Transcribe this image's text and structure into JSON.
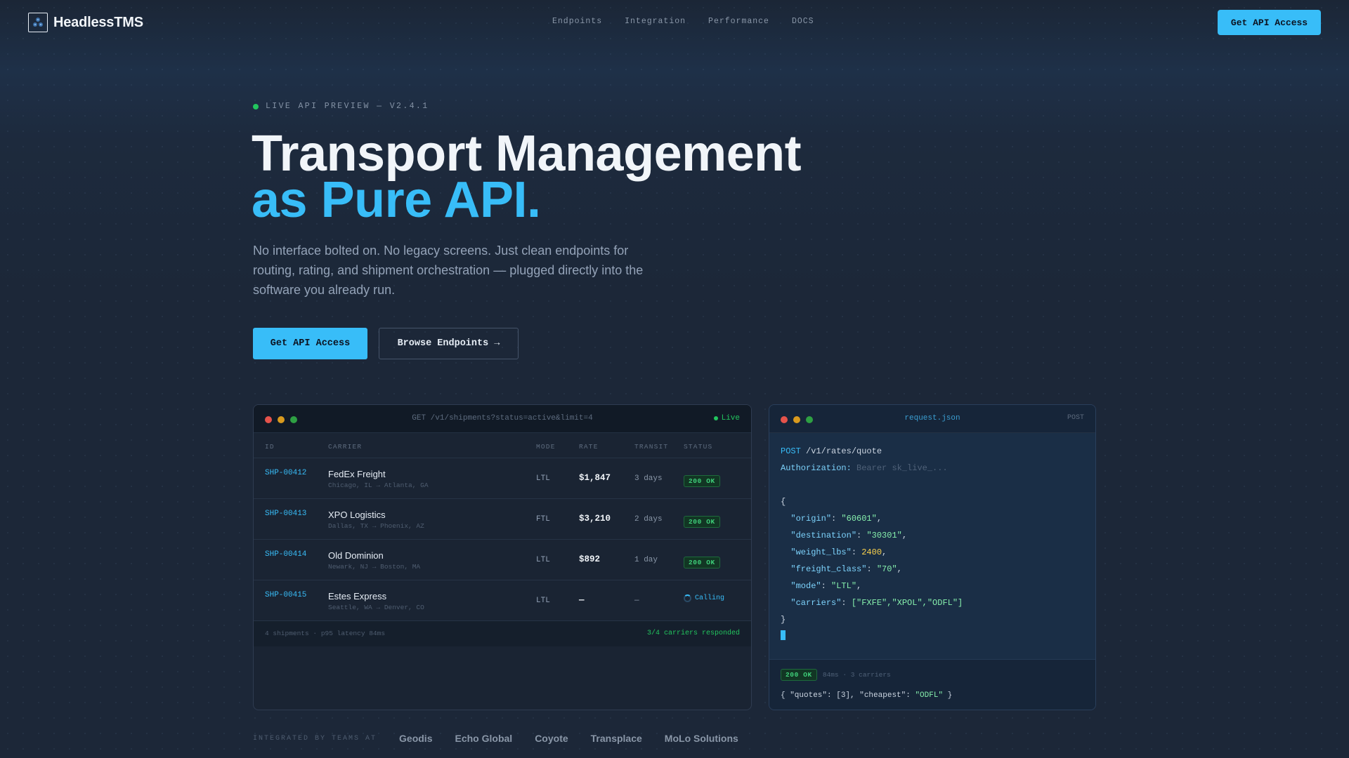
{
  "nav": {
    "logo_text": "HeadlessTMS",
    "links": [
      "Endpoints",
      "Integration",
      "Performance",
      "DOCS"
    ],
    "cta": "Get API Access"
  },
  "hero": {
    "eyebrow": "LIVE API PREVIEW — V2.4.1",
    "title_line1": "Transport Management",
    "title_line2": "as Pure API.",
    "lede": "No interface bolted on. No legacy screens. Just clean endpoints for routing, rating, and shipment orchestration — plugged directly into the software you already run.",
    "primary_button": "Get API Access",
    "secondary_button": "Browse Endpoints →"
  },
  "shipments_panel": {
    "request": "GET /v1/shipments?status=active&limit=4",
    "live_label": "Live",
    "columns": [
      "ID",
      "CARRIER",
      "MODE",
      "RATE",
      "TRANSIT",
      "STATUS"
    ],
    "rows": [
      {
        "id": "SHP-00412",
        "carrier": "FedEx Freight",
        "route": "Chicago, IL → Atlanta, GA",
        "mode": "LTL",
        "rate": "$1,847",
        "transit": "3 days",
        "status": "200 OK"
      },
      {
        "id": "SHP-00413",
        "carrier": "XPO Logistics",
        "route": "Dallas, TX → Phoenix, AZ",
        "mode": "FTL",
        "rate": "$3,210",
        "transit": "2 days",
        "status": "200 OK"
      },
      {
        "id": "SHP-00414",
        "carrier": "Old Dominion",
        "route": "Newark, NJ → Boston, MA",
        "mode": "LTL",
        "rate": "$892",
        "transit": "1 day",
        "status": "200 OK"
      },
      {
        "id": "SHP-00415",
        "carrier": "Estes Express",
        "route": "Seattle, WA → Denver, CO",
        "mode": "LTL",
        "rate": "—",
        "transit": "—",
        "status": "Calling"
      }
    ],
    "footer_left": "4 shipments · p95 latency 84ms",
    "footer_right": "3/4 carriers responded"
  },
  "request_panel": {
    "filename": "request.json",
    "method_tag": "POST",
    "method": "POST",
    "path": "/v1/rates/quote",
    "auth_key": "Authorization:",
    "auth_value": "Bearer sk_live_...",
    "body": [
      {
        "key": "\"origin\"",
        "value": "\"60601\"",
        "type": "str"
      },
      {
        "key": "\"destination\"",
        "value": "\"30301\"",
        "type": "str"
      },
      {
        "key": "\"weight_lbs\"",
        "value": "2400",
        "type": "num"
      },
      {
        "key": "\"freight_class\"",
        "value": "\"70\"",
        "type": "str"
      },
      {
        "key": "\"mode\"",
        "value": "\"LTL\"",
        "type": "str"
      },
      {
        "key": "\"carriers\"",
        "value": "[\"FXFE\",\"XPOL\",\"ODFL\"]",
        "type": "str"
      }
    ],
    "response_status": "200 OK",
    "response_meta": "84ms · 3 carriers",
    "response_quotes_key": "\"quotes\"",
    "response_quotes_val": "[3]",
    "response_cheapest_key": "\"cheapest\"",
    "response_cheapest_val": "\"ODFL\""
  },
  "logos": {
    "label": "INTEGRATED BY TEAMS AT",
    "brands": [
      "Geodis",
      "Echo Global",
      "Coyote",
      "Transplace",
      "MoLo Solutions"
    ]
  },
  "colors": {
    "accent": "#38bdf8",
    "success": "#22c55e",
    "background": "#1c2738"
  },
  "icons": {
    "logo": "network-cube-icon",
    "spinner": "loading-spinner-icon"
  }
}
